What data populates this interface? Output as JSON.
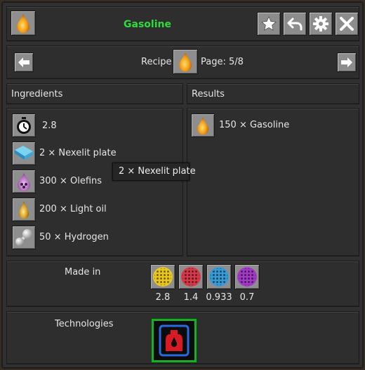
{
  "header": {
    "title": "Gasoline",
    "icon": "gasoline-drop-icon"
  },
  "nav": {
    "recipe_label": "Recipe",
    "page_label": "Page: 5/8"
  },
  "ingredients": {
    "heading": "Ingredients",
    "items": [
      {
        "icon": "clock-icon",
        "text": "2.8"
      },
      {
        "icon": "nexelit-plate-icon",
        "text": "2 × Nexelit plate"
      },
      {
        "icon": "olefins-icon",
        "text": "300 × Olefins"
      },
      {
        "icon": "light-oil-icon",
        "text": "200 × Light oil"
      },
      {
        "icon": "hydrogen-icon",
        "text": "50 × Hydrogen"
      }
    ]
  },
  "tooltip": {
    "text": "2 × Nexelit plate"
  },
  "results": {
    "heading": "Results",
    "items": [
      {
        "icon": "gasoline-drop-icon",
        "text": "150 × Gasoline"
      }
    ]
  },
  "made_in": {
    "heading": "Made in",
    "machines": [
      {
        "color": "#e8c81e",
        "value": "2.8"
      },
      {
        "color": "#d43a4a",
        "value": "1.4"
      },
      {
        "color": "#3a9ad4",
        "value": "0.933"
      },
      {
        "color": "#a43ac4",
        "value": "0.7"
      }
    ]
  },
  "technologies": {
    "heading": "Technologies"
  },
  "colors": {
    "title_green": "#2bdc3c",
    "gasoline_orange": "#f39a12",
    "tech_green": "#1faa2c"
  }
}
